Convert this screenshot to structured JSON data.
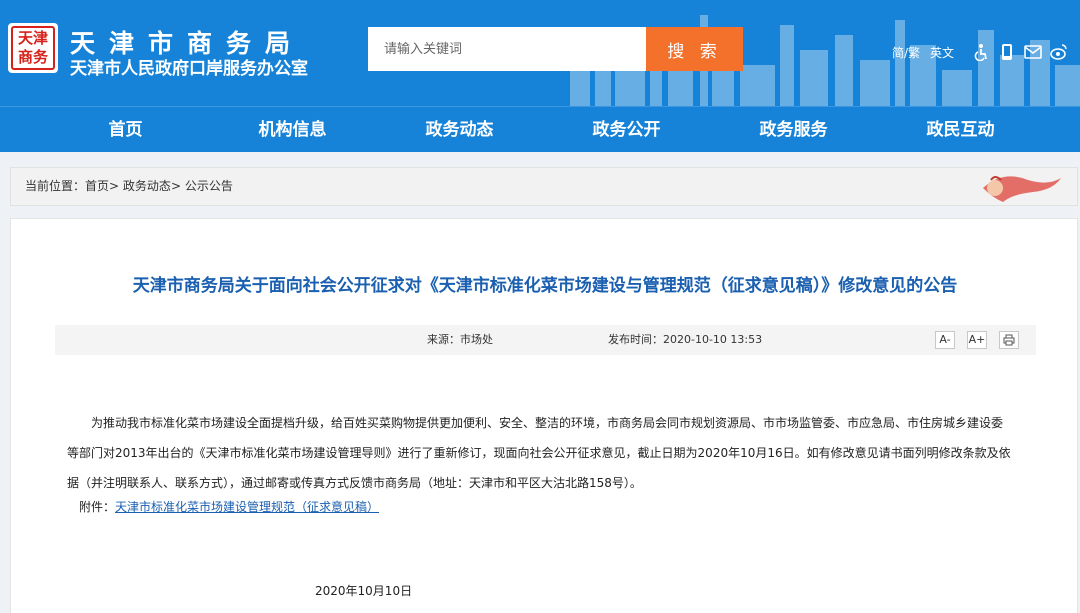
{
  "header": {
    "emblem_text": "天津商务",
    "site_name": "天津市商务局",
    "site_sub": "天津市人民政府口岸服务办公室",
    "search_placeholder": "请输入关键词",
    "search_button": "搜 索",
    "lang_simple_trad": "简/繁",
    "lang_english": "英文",
    "icons": [
      "accessibility-icon",
      "mobile-icon",
      "mail-icon",
      "weibo-icon"
    ]
  },
  "nav": {
    "items": [
      {
        "label": "首页"
      },
      {
        "label": "机构信息"
      },
      {
        "label": "政务动态"
      },
      {
        "label": "政务公开"
      },
      {
        "label": "政务服务"
      },
      {
        "label": "政民互动"
      }
    ]
  },
  "breadcrumb": {
    "prefix": "当前位置：",
    "items": [
      "首页",
      "政务动态",
      "公示公告"
    ],
    "separator": ">"
  },
  "article": {
    "title": "天津市商务局关于面向社会公开征求对《天津市标准化菜市场建设与管理规范（征求意见稿）》修改意见的公告",
    "source": "来源：市场处",
    "publish_time": "发布时间：2020-10-10 13:53",
    "font_smaller": "A-",
    "font_larger": "A+",
    "body_line1": "为推动我市标准化菜市场建设全面提档升级，给百姓买菜购物提供更加便利、安全、整洁的环境，市商务局会同市规划资源局、市市场监管委、市应急局、市住房城乡建设委",
    "body_line2": "等部门对2013年出台的《天津市标准化菜市场建设管理导则》进行了重新修订，现面向社会公开征求意见，截止日期为2020年10月16日。如有修改意见请书面列明修改条款及依",
    "body_line3": "据（并注明联系人、联系方式），通过邮寄或传真方式反馈市商务局（地址：天津市和平区大沽北路158号）。",
    "attachment_label": "附件：",
    "attachment_link": "天津市标准化菜市场建设管理规范（征求意见稿）",
    "sign_date": "2020年10月10日"
  },
  "colors": {
    "header_blue": "#1683d8",
    "search_orange": "#f3712b",
    "title_blue": "#1a5fb0",
    "emblem_red": "#d6221a"
  }
}
